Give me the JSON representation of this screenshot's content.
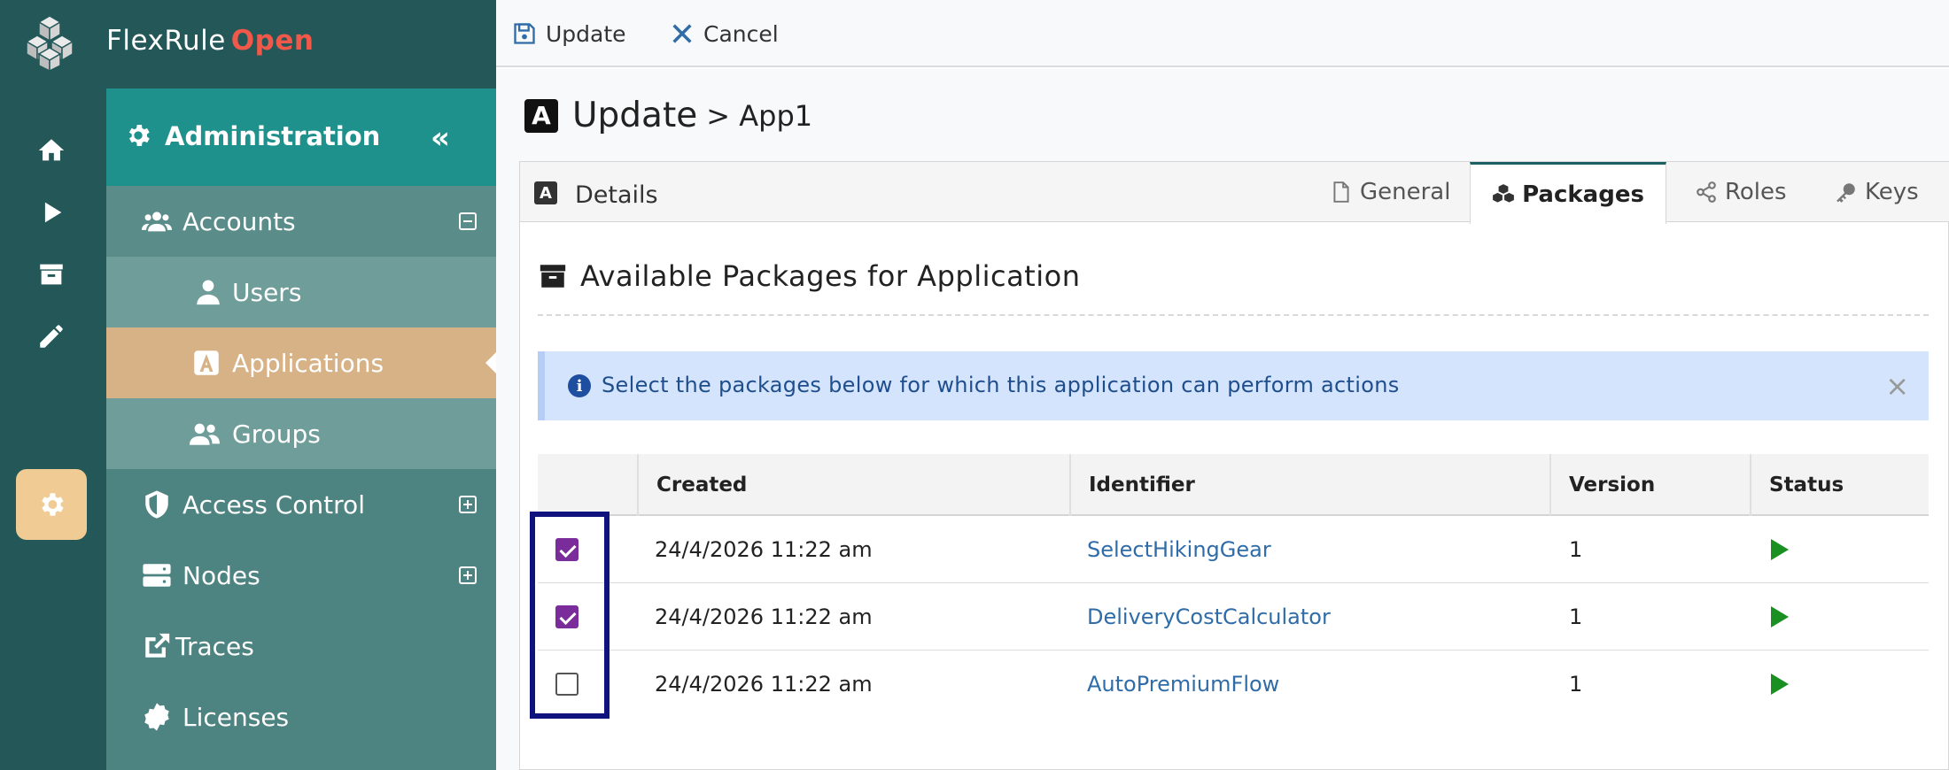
{
  "brand": {
    "name": "FlexRule",
    "edition": "Open"
  },
  "rail": {
    "items": [
      {
        "icon": "home-icon"
      },
      {
        "icon": "play-icon"
      },
      {
        "icon": "archive-icon"
      },
      {
        "icon": "pencil-icon"
      },
      {
        "icon": "gear-icon",
        "active": true
      }
    ]
  },
  "menu": {
    "title": "Administration",
    "collapse_label": "«",
    "items": [
      {
        "label": "Accounts",
        "icon": "users-icon",
        "expanded": true
      },
      {
        "label": "Users",
        "icon": "user-icon"
      },
      {
        "label": "Applications",
        "icon": "app-icon",
        "active": true
      },
      {
        "label": "Groups",
        "icon": "group-icon"
      },
      {
        "label": "Access Control",
        "icon": "shield-icon",
        "expanded": false
      },
      {
        "label": "Nodes",
        "icon": "server-icon",
        "expanded": false
      },
      {
        "label": "Traces",
        "icon": "external-link-icon"
      },
      {
        "label": "Licenses",
        "icon": "certificate-icon"
      }
    ]
  },
  "toolbar": {
    "update_label": "Update",
    "cancel_label": "Cancel"
  },
  "page": {
    "title": "Update",
    "crumb": "> App1",
    "app_letter": "A"
  },
  "card": {
    "header_label": "Details",
    "tabs": [
      {
        "label": "General",
        "icon": "file-icon"
      },
      {
        "label": "Packages",
        "icon": "cubes-icon",
        "active": true
      },
      {
        "label": "Roles",
        "icon": "share-icon"
      },
      {
        "label": "Keys",
        "icon": "key-icon"
      }
    ]
  },
  "section": {
    "title": "Available Packages for Application"
  },
  "alert": {
    "message": "Select the packages below for which this application can perform actions",
    "close": "×",
    "info": "i"
  },
  "table": {
    "columns": [
      "",
      "Created",
      "Identifier",
      "Version",
      "Status"
    ],
    "rows": [
      {
        "checked": true,
        "created": "24/4/2026 11:22 am",
        "identifier": "SelectHikingGear",
        "version": "1",
        "status": "running"
      },
      {
        "checked": true,
        "created": "24/4/2026 11:22 am",
        "identifier": "DeliveryCostCalculator",
        "version": "1",
        "status": "running"
      },
      {
        "checked": false,
        "created": "24/4/2026 11:22 am",
        "identifier": "AutoPremiumFlow",
        "version": "1",
        "status": "running"
      }
    ]
  },
  "colors": {
    "sidebar": "#245858",
    "menu": "#4d8380",
    "menu_head": "#1f918d",
    "active_item": "#d6b286",
    "accent": "#f0584a",
    "checkbox": "#7b2c9b",
    "status_green": "#1a8f22"
  }
}
